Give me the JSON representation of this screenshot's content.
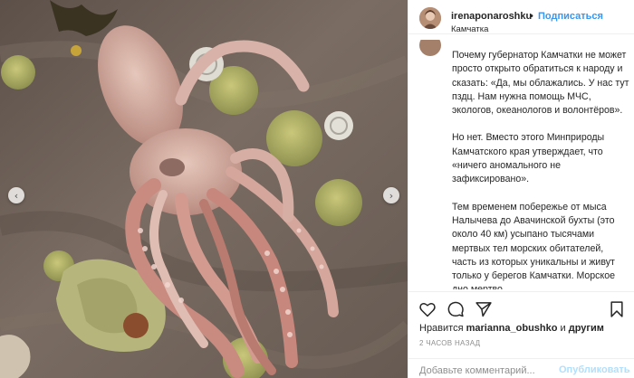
{
  "post": {
    "username": "irenaponaroshku",
    "separator": "•",
    "follow_label": "Подписаться",
    "location": "Камчатка",
    "caption": [
      "Почему губернатор Камчатки не может просто открыто обратиться к народу и сказать: «Да, мы облажались. У нас тут пздц. Нам нужна помощь МЧС, экологов, океанологов и волонтёров».",
      "Но нет. Вместо этого Минприроды Камчатского края утверждает, что «ничего аномального не зафиксировано».",
      "Тем временем побережье от мыса Налычева до Авачинской бухты (это около 40 км) усыпано тысячами мертвых тел морских обитателей, часть из которых уникальны и живут только у берегов Камчатки. Морское дно мертво."
    ],
    "likes_prefix": "Нравится",
    "likes_user": "marianna_obushko",
    "likes_conj": "и",
    "likes_suffix": "другим",
    "time_ago": "2 ЧАСОВ НАЗАД",
    "comment_placeholder": "Добавьте комментарий...",
    "publish_label": "Опубликовать"
  },
  "icons": {
    "prev": "chevron-left-icon",
    "next": "chevron-right-icon",
    "like": "heart-icon",
    "comment": "comment-icon",
    "share": "share-icon",
    "save": "bookmark-icon"
  },
  "colors": {
    "follow": "#3897f0",
    "publish_disabled": "#b2dffc",
    "muted": "#8e8e8e",
    "text": "#262626"
  }
}
